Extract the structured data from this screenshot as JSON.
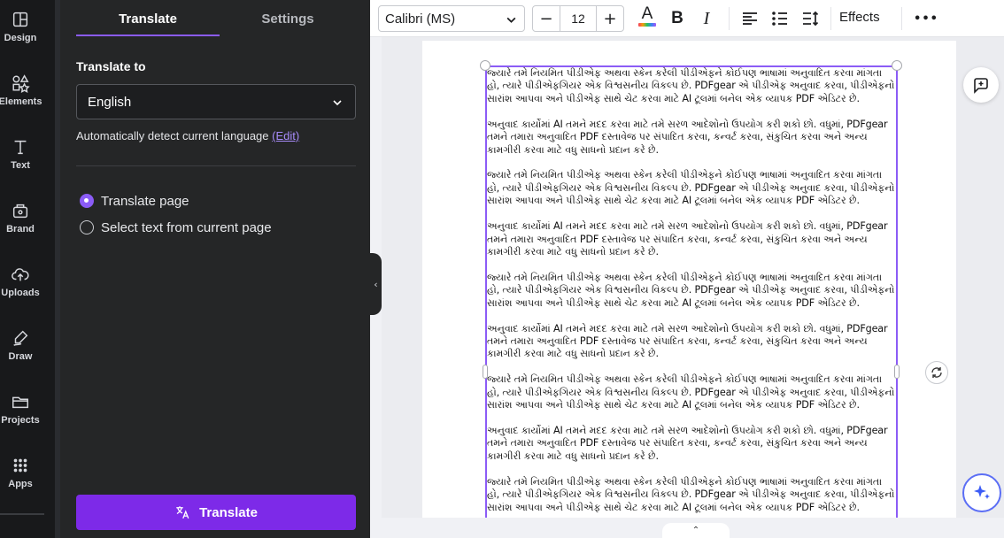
{
  "rail": {
    "items": [
      {
        "label": "Design",
        "icon": "design-icon"
      },
      {
        "label": "Elements",
        "icon": "elements-icon"
      },
      {
        "label": "Text",
        "icon": "text-icon"
      },
      {
        "label": "Brand",
        "icon": "brand-icon"
      },
      {
        "label": "Uploads",
        "icon": "uploads-icon"
      },
      {
        "label": "Draw",
        "icon": "draw-icon"
      },
      {
        "label": "Projects",
        "icon": "projects-icon"
      },
      {
        "label": "Apps",
        "icon": "apps-icon"
      }
    ]
  },
  "panel": {
    "tabs": [
      {
        "label": "Translate",
        "active": true
      },
      {
        "label": "Settings",
        "active": false
      }
    ],
    "translate_to_label": "Translate to",
    "language_value": "English",
    "detect_text": "Automatically detect current language",
    "detect_edit": "(Edit)",
    "options": [
      {
        "label": "Translate page",
        "selected": true
      },
      {
        "label": "Select text from current page",
        "selected": false
      }
    ],
    "translate_button": "Translate"
  },
  "toolbar": {
    "font_family_value": "Calibri (MS)",
    "font_size_value": "12",
    "minus": "−",
    "plus": "+",
    "bold": "B",
    "italic": "I",
    "effects": "Effects",
    "more": "•••",
    "text_color_glyph": "A"
  },
  "document": {
    "para_a": "જ્યારે તમે નિયમિત પીડીએફ અથવા સ્કેન કરેલી પીડીએફને કોઈપણ ભાષામાં અનુવાદિત કરવા માંગતા હો, ત્યારે પીડીએફગિયર એક વિશ્વસનીય વિકલ્પ છે. PDFgear એ પીડીએફ અનુવાદ કરવા, પીડીએફનો સારાંશ આપવા અને પીડીએફ સાથે ચેટ કરવા માટે AI ટૂલમાં બનેલ એક વ્યાપક PDF એડિટર છે.",
    "para_b": "અનુવાદ કાર્યોમાં AI તમને મદદ કરવા માટે તમે સરળ આદેશોનો ઉપયોગ કરી શકો છો. વધુમાં, PDFgear તમને તમારા અનુવાદિત PDF દસ્તાવેજ પર સંપાદિત કરવા, કન્વર્ટ કરવા, સંકુચિત કરવા અને અન્ય કામગીરી કરવા માટે વધુ સાધનો પ્રદાન કરે છે."
  },
  "colors": {
    "accent": "#8b5cf6",
    "button": "#7d2ae8",
    "panel_bg": "#252627",
    "rail_bg": "#18191b"
  }
}
